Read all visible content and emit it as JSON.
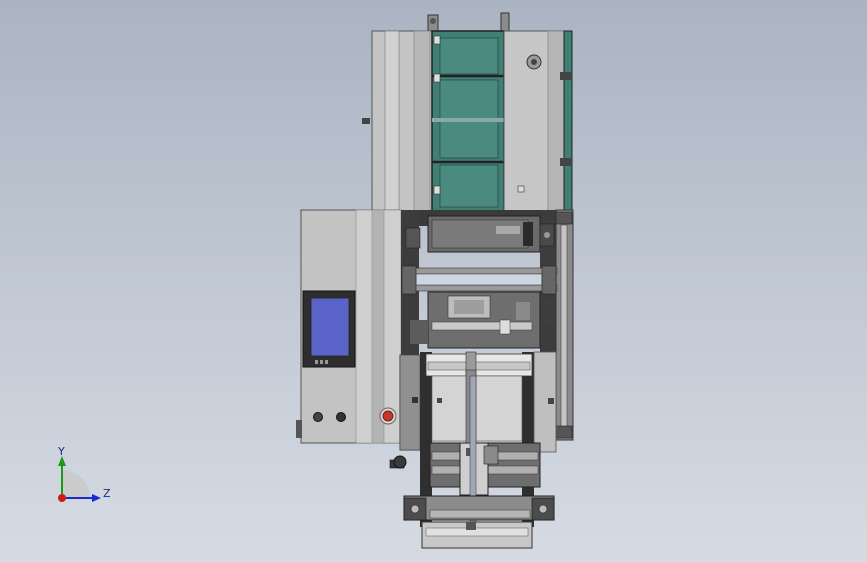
{
  "triad": {
    "y_label": "Y",
    "z_label": "Z",
    "y_color": "#1a9a1a",
    "z_color": "#1a2ad0",
    "x_color": "#d01a1a"
  },
  "colors": {
    "frame_gray": "#b9b9b9",
    "panel_gray": "#c8c8c8",
    "dark_gray": "#4a4a4a",
    "teal_glass": "#3f7f74",
    "screen_blue": "#5a63c8",
    "stop_red": "#c0392b"
  },
  "model": {
    "description_hidden": ""
  }
}
